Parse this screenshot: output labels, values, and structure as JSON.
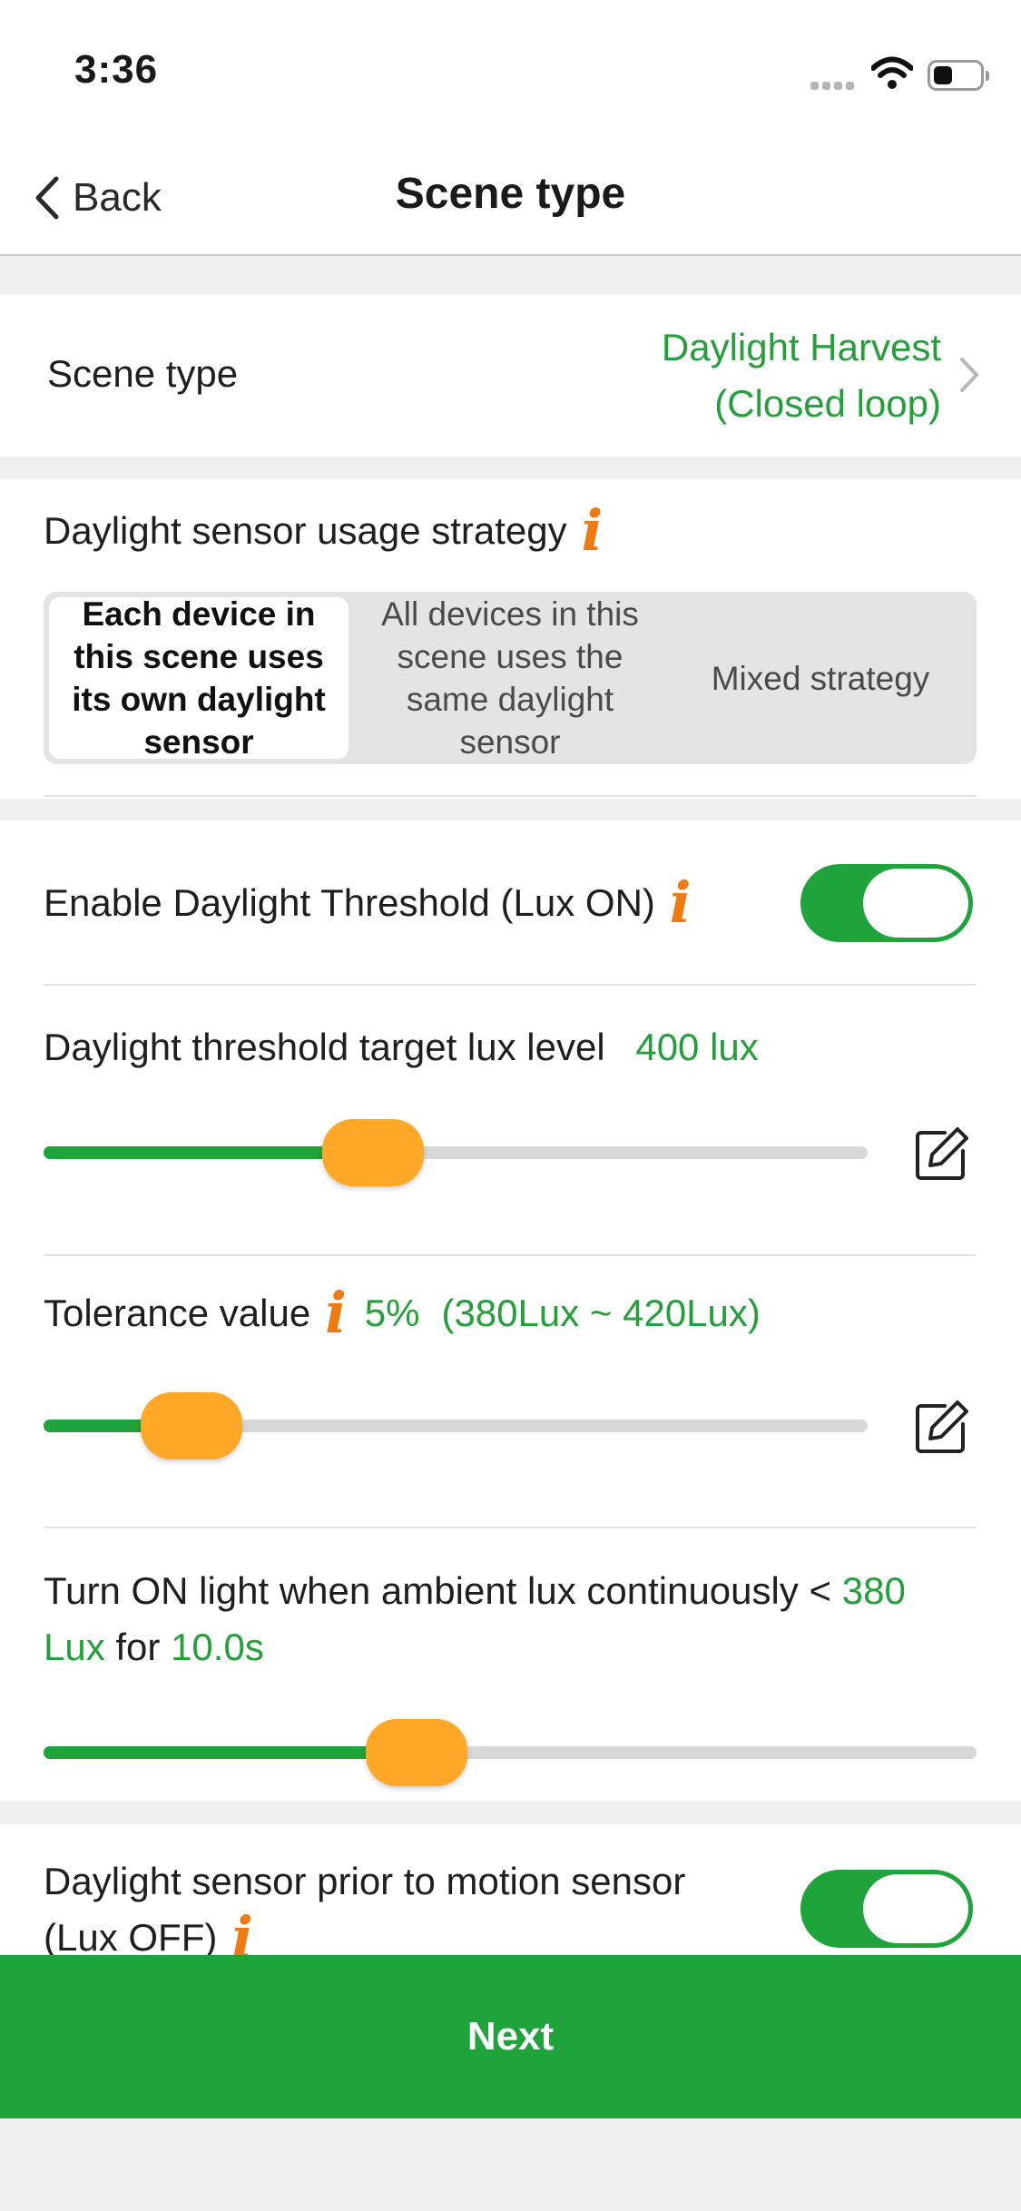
{
  "status_bar": {
    "time": "3:36"
  },
  "nav": {
    "back_label": "Back",
    "title": "Scene type"
  },
  "scene_type": {
    "label": "Scene type",
    "value_line1": "Daylight Harvest",
    "value_line2": "(Closed loop)"
  },
  "strategy": {
    "label": "Daylight sensor usage strategy",
    "info_icon": "i",
    "options": [
      {
        "line1": "Each device in",
        "line2": "this scene uses",
        "line3": "its own daylight",
        "line4": "sensor",
        "selected": true
      },
      {
        "line1": "All devices in this",
        "line2": "scene uses the",
        "line3": "same daylight",
        "line4": "sensor",
        "selected": false
      },
      {
        "line1": "Mixed strategy",
        "selected": false
      }
    ]
  },
  "threshold_toggle": {
    "label": "Enable Daylight Threshold (Lux ON)",
    "info_icon": "i",
    "on": true
  },
  "target_lux": {
    "label": "Daylight threshold target lux level",
    "value": "400 lux",
    "slider_fraction": 0.4
  },
  "tolerance": {
    "label": "Tolerance value",
    "info_icon": "i",
    "percent": "5%",
    "range": "(380Lux ~ 420Lux)",
    "slider_fraction": 0.18
  },
  "turn_on": {
    "text_prefix": "Turn ON light when ambient lux continuously <",
    "lux_value_part1": "380",
    "lux_value_part2": "Lux",
    "text_for": "for",
    "duration": "10.0s",
    "slider_fraction": 0.4
  },
  "motion_toggle": {
    "label_line1": "Daylight sensor prior to motion sensor",
    "label_line2": "(Lux OFF)",
    "info_icon": "i",
    "on": true
  },
  "next_button": {
    "label": "Next"
  },
  "colors": {
    "accent_green": "#1fa33b",
    "text_green": "#23a03a",
    "thumb_orange": "#ffa828",
    "info_orange": "#f07a12"
  }
}
